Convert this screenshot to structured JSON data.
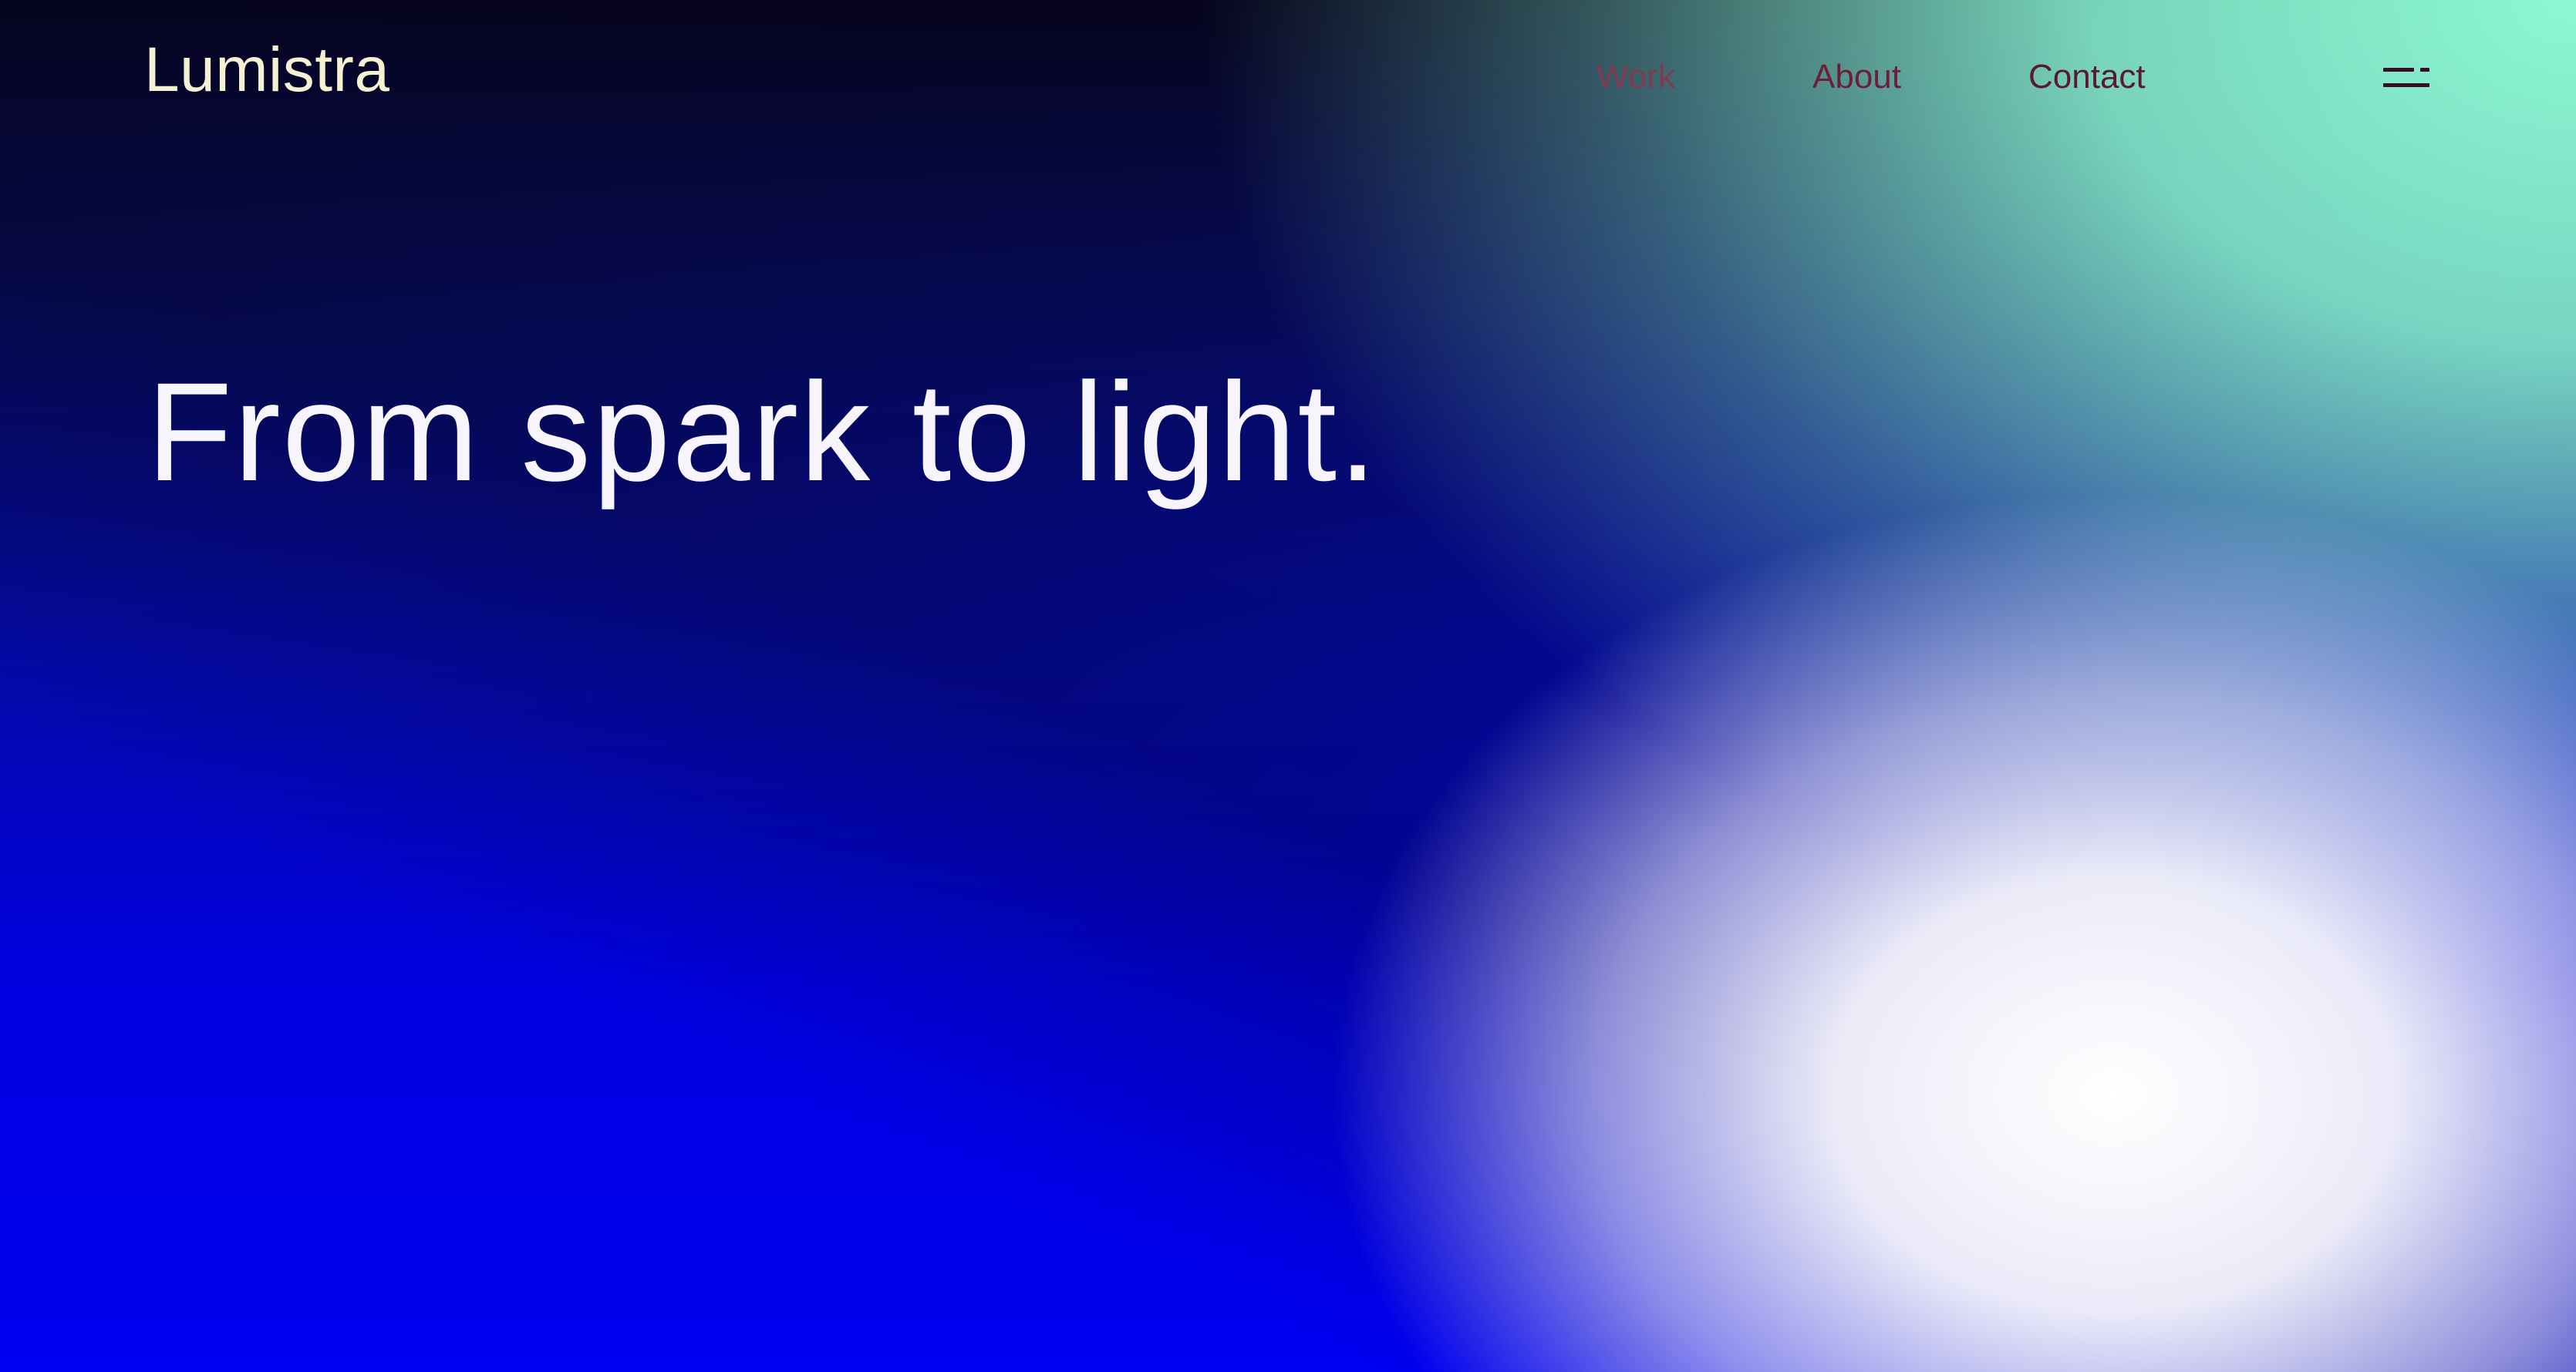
{
  "brand": {
    "name": "Lumistra"
  },
  "nav": {
    "items": [
      {
        "label": "Work"
      },
      {
        "label": "About"
      },
      {
        "label": "Contact"
      }
    ],
    "menu_icon": "menu-icon"
  },
  "hero": {
    "headline": "From spark to light."
  },
  "colors": {
    "background_dark": "#06041c",
    "background_blue": "#0000f2",
    "background_mint": "#8cf8d4",
    "background_white": "#ffffff",
    "brand_text": "#f6f1d2",
    "nav_text": "#6d1f3a",
    "headline_text": "#f7f5fb"
  }
}
